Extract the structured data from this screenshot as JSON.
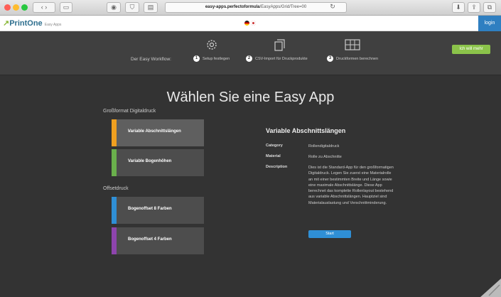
{
  "browser": {
    "url_host": "easy-apps.perfectoformula",
    "url_path": "/EasyApps/Grid/Tree=00",
    "colors": {
      "close": "#ff5f57",
      "min": "#febc2e",
      "max": "#28c840"
    }
  },
  "header": {
    "logo_text": "Print",
    "logo_text2": "One",
    "logo_sub": "Easy Apps",
    "login_label": "login"
  },
  "workflow": {
    "label": "Der Easy Workflow:",
    "steps": [
      {
        "num": "1",
        "label": "Setup festlegen",
        "icon": "gear-icon"
      },
      {
        "num": "2",
        "label": "CSV-Import für Druckprodukte",
        "icon": "pages-icon"
      },
      {
        "num": "3",
        "label": "Druckformen berechnen",
        "icon": "grid-icon"
      }
    ],
    "cta_label": "Ich will mehr"
  },
  "main": {
    "title": "Wählen Sie eine Easy App",
    "groups": [
      {
        "label": "Großformat Digitaldruck",
        "apps": [
          {
            "label": "Variable Abschnittslängen",
            "color": "#f0a020",
            "active": true
          },
          {
            "label": "Variable Bogenhöhen",
            "color": "#6ab04c",
            "active": false
          }
        ]
      },
      {
        "label": "Offsetdruck",
        "apps": [
          {
            "label": "Bogenoffset 8 Farben",
            "color": "#2f8fd6",
            "active": false
          },
          {
            "label": "Bogenoffset 4 Farben",
            "color": "#8e44ad",
            "active": false
          }
        ]
      }
    ],
    "detail": {
      "title": "Variable Abschnittslängen",
      "fields": [
        {
          "label": "Category",
          "value": "Rollendigitaldruck"
        },
        {
          "label": "Material",
          "value": "Rolle zu Abschnitte"
        },
        {
          "label": "Description",
          "value": "Dies ist die Standard-App für den großformatigen Digitaldruck. Legen Sie zuerst eine Materialrolle an mit einer bestimmten Breite und Länge sowie eine maximale Abschnittslänge. Diese App berechnet das komplette Rollenlayout bestehend aus variable Abschnittslängen. Hauptziel sind Materialauslastung und Verschnittminderung."
        }
      ],
      "start_label": "Start"
    }
  }
}
